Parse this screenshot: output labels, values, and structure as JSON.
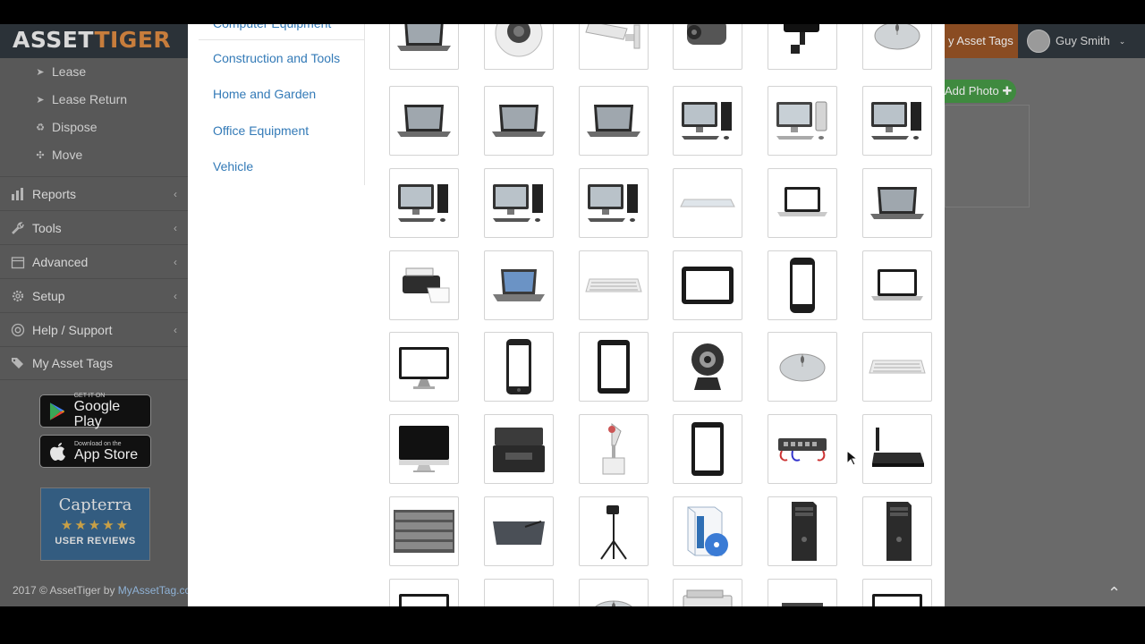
{
  "app": {
    "logo_part1": "ASSET",
    "logo_part2": "TIGER",
    "header": {
      "tags_button": "y Asset Tags",
      "user_name": "Guy Smith"
    },
    "sidebar": {
      "sub_items": [
        {
          "label": "Lease",
          "icon": "send-icon"
        },
        {
          "label": "Lease Return",
          "icon": "send-icon"
        },
        {
          "label": "Dispose",
          "icon": "recycle-icon"
        },
        {
          "label": "Move",
          "icon": "move-icon"
        }
      ],
      "items": [
        {
          "label": "Reports",
          "icon": "chart-icon",
          "has_chevron": true
        },
        {
          "label": "Tools",
          "icon": "wrench-icon",
          "has_chevron": true
        },
        {
          "label": "Advanced",
          "icon": "calendar-icon",
          "has_chevron": true
        },
        {
          "label": "Setup",
          "icon": "gear-icon",
          "has_chevron": true
        },
        {
          "label": "Help / Support",
          "icon": "lifebuoy-icon",
          "has_chevron": true
        },
        {
          "label": "My Asset Tags",
          "icon": "tags-icon",
          "has_chevron": false
        }
      ],
      "google_play": {
        "small": "GET IT ON",
        "big": "Google Play"
      },
      "app_store": {
        "small": "Download on the",
        "big": "App Store"
      },
      "capterra": {
        "name": "Capterra",
        "stars": "★★★★★",
        "label": "USER REVIEWS"
      },
      "footer_prefix": "2017 © AssetTiger by ",
      "footer_link": "MyAssetTag.com"
    },
    "add_photo_label": "Add Photo ✚"
  },
  "modal": {
    "top_category": "Computer Equipment",
    "categories": [
      "Construction and Tools",
      "Home and Garden",
      "Office Equipment",
      "Vehicle"
    ],
    "grid_rows": [
      [
        "laptop",
        "dome-camera",
        "bullet-camera",
        "cctv-camera",
        "ptz-camera",
        "mouse"
      ],
      [
        "laptop",
        "laptop",
        "laptop",
        "desktop",
        "desktop-silver",
        "desktop"
      ],
      [
        "desktop",
        "desktop",
        "desktop",
        "thin-device",
        "macbook",
        "laptop"
      ],
      [
        "printer",
        "laptop-blue",
        "keyboard",
        "tablet-landscape",
        "smartphone",
        "laptop-outline"
      ],
      [
        "monitor",
        "phone",
        "tablet",
        "webcam",
        "mouse",
        "keyboard"
      ],
      [
        "imac",
        "laser-printer",
        "projector",
        "tablet",
        "network-switch",
        "router"
      ],
      [
        "server-rack",
        "drawing-tablet",
        "light-stand",
        "software-box",
        "tower-pc",
        "tower-pc"
      ],
      [
        "monitor",
        "keyboard",
        "mouse",
        "copier",
        "scanner",
        "monitor"
      ]
    ]
  }
}
